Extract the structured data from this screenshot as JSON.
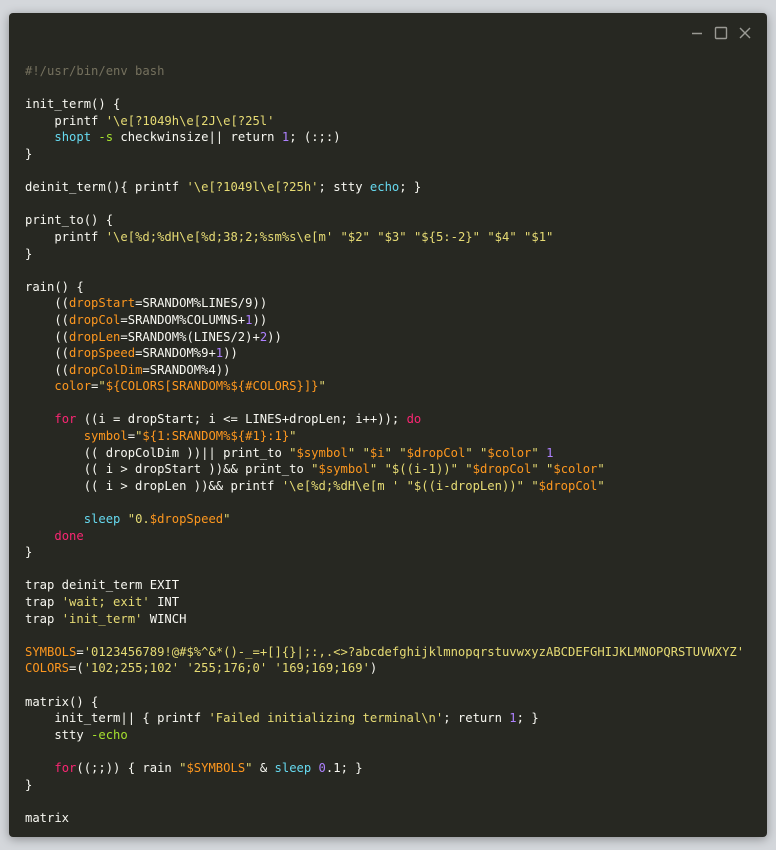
{
  "window": {
    "controls": [
      {
        "name": "minimize-button",
        "icon": "minimize-icon"
      },
      {
        "name": "maximize-button",
        "icon": "maximize-icon"
      },
      {
        "name": "close-button",
        "icon": "close-icon"
      }
    ]
  },
  "colors": {
    "background": "#272822",
    "text": "#f8f8f2",
    "comment": "#75715e",
    "string": "#e6db74",
    "builtin": "#66d9ef",
    "keyword": "#f92672",
    "number": "#ae81ff",
    "variable": "#fd971f",
    "flag": "#a6e22e"
  },
  "code_lines": [
    [
      [
        "comment",
        "#!/usr/bin/env bash"
      ]
    ],
    [],
    [
      [
        "default",
        "init_term() {"
      ]
    ],
    [
      [
        "default",
        "    printf "
      ],
      [
        "string",
        "'\\e[?1049h\\e[2J\\e[?25l'"
      ]
    ],
    [
      [
        "default",
        "    "
      ],
      [
        "builtin",
        "shopt"
      ],
      [
        "default",
        " "
      ],
      [
        "flag",
        "-s"
      ],
      [
        "default",
        " checkwinsize|| return "
      ],
      [
        "number",
        "1"
      ],
      [
        "default",
        "; (:;:)"
      ]
    ],
    [
      [
        "default",
        "}"
      ]
    ],
    [],
    [
      [
        "default",
        "deinit_term(){ printf "
      ],
      [
        "string",
        "'\\e[?1049l\\e[?25h'"
      ],
      [
        "default",
        "; stty "
      ],
      [
        "builtin",
        "echo"
      ],
      [
        "default",
        "; }"
      ]
    ],
    [],
    [
      [
        "default",
        "print_to() {"
      ]
    ],
    [
      [
        "default",
        "    printf "
      ],
      [
        "string",
        "'\\e[%d;%dH\\e[%d;38;2;%sm%s\\e[m'"
      ],
      [
        "default",
        " "
      ],
      [
        "string",
        "\"$2\""
      ],
      [
        "default",
        " "
      ],
      [
        "string",
        "\"$3\""
      ],
      [
        "default",
        " "
      ],
      [
        "string",
        "\"${5:-2}\""
      ],
      [
        "default",
        " "
      ],
      [
        "string",
        "\"$4\""
      ],
      [
        "default",
        " "
      ],
      [
        "string",
        "\"$1\""
      ]
    ],
    [
      [
        "default",
        "}"
      ]
    ],
    [],
    [
      [
        "default",
        "rain() {"
      ]
    ],
    [
      [
        "default",
        "    (("
      ],
      [
        "var",
        "dropStart"
      ],
      [
        "default",
        "=SRANDOM%LINES/9))"
      ]
    ],
    [
      [
        "default",
        "    (("
      ],
      [
        "var",
        "dropCol"
      ],
      [
        "default",
        "=SRANDOM%COLUMNS+"
      ],
      [
        "number",
        "1"
      ],
      [
        "default",
        "))"
      ]
    ],
    [
      [
        "default",
        "    (("
      ],
      [
        "var",
        "dropLen"
      ],
      [
        "default",
        "=SRANDOM%(LINES/2)+"
      ],
      [
        "number",
        "2"
      ],
      [
        "default",
        "))"
      ]
    ],
    [
      [
        "default",
        "    (("
      ],
      [
        "var",
        "dropSpeed"
      ],
      [
        "default",
        "=SRANDOM%9+"
      ],
      [
        "number",
        "1"
      ],
      [
        "default",
        "))"
      ]
    ],
    [
      [
        "default",
        "    (("
      ],
      [
        "var",
        "dropColDim"
      ],
      [
        "default",
        "=SRANDOM%4))"
      ]
    ],
    [
      [
        "default",
        "    "
      ],
      [
        "var",
        "color"
      ],
      [
        "default",
        "="
      ],
      [
        "string",
        "\""
      ],
      [
        "var",
        "${COLORS[SRANDOM%${#COLORS}]}"
      ],
      [
        "string",
        "\""
      ]
    ],
    [],
    [
      [
        "default",
        "    "
      ],
      [
        "keyword",
        "for"
      ],
      [
        "default",
        " ((i = dropStart; i <= LINES+dropLen; i++)); "
      ],
      [
        "keyword",
        "do"
      ]
    ],
    [
      [
        "default",
        "        "
      ],
      [
        "var",
        "symbol"
      ],
      [
        "default",
        "="
      ],
      [
        "string",
        "\""
      ],
      [
        "var",
        "${1:SRANDOM%${#1}:1}"
      ],
      [
        "string",
        "\""
      ]
    ],
    [
      [
        "default",
        "        (( dropColDim ))|| print_to "
      ],
      [
        "string",
        "\""
      ],
      [
        "var",
        "$symbol"
      ],
      [
        "string",
        "\""
      ],
      [
        "default",
        " "
      ],
      [
        "string",
        "\""
      ],
      [
        "var",
        "$i"
      ],
      [
        "string",
        "\""
      ],
      [
        "default",
        " "
      ],
      [
        "string",
        "\""
      ],
      [
        "var",
        "$dropCol"
      ],
      [
        "string",
        "\""
      ],
      [
        "default",
        " "
      ],
      [
        "string",
        "\""
      ],
      [
        "var",
        "$color"
      ],
      [
        "string",
        "\""
      ],
      [
        "default",
        " "
      ],
      [
        "number",
        "1"
      ]
    ],
    [
      [
        "default",
        "        (( i > dropStart ))&& print_to "
      ],
      [
        "string",
        "\""
      ],
      [
        "var",
        "$symbol"
      ],
      [
        "string",
        "\""
      ],
      [
        "default",
        " "
      ],
      [
        "string",
        "\"$((i-1))\""
      ],
      [
        "default",
        " "
      ],
      [
        "string",
        "\""
      ],
      [
        "var",
        "$dropCol"
      ],
      [
        "string",
        "\""
      ],
      [
        "default",
        " "
      ],
      [
        "string",
        "\""
      ],
      [
        "var",
        "$color"
      ],
      [
        "string",
        "\""
      ]
    ],
    [
      [
        "default",
        "        (( i > dropLen ))&& printf "
      ],
      [
        "string",
        "'\\e[%d;%dH\\e[m '"
      ],
      [
        "default",
        " "
      ],
      [
        "string",
        "\"$((i-dropLen))\""
      ],
      [
        "default",
        " "
      ],
      [
        "string",
        "\""
      ],
      [
        "var",
        "$dropCol"
      ],
      [
        "string",
        "\""
      ]
    ],
    [],
    [
      [
        "default",
        "        "
      ],
      [
        "builtin",
        "sleep"
      ],
      [
        "default",
        " "
      ],
      [
        "string",
        "\"0."
      ],
      [
        "var",
        "$dropSpeed"
      ],
      [
        "string",
        "\""
      ]
    ],
    [
      [
        "default",
        "    "
      ],
      [
        "keyword",
        "done"
      ]
    ],
    [
      [
        "default",
        "}"
      ]
    ],
    [],
    [
      [
        "default",
        "trap deinit_term EXIT"
      ]
    ],
    [
      [
        "default",
        "trap "
      ],
      [
        "string",
        "'wait; exit'"
      ],
      [
        "default",
        " INT"
      ]
    ],
    [
      [
        "default",
        "trap "
      ],
      [
        "string",
        "'init_term'"
      ],
      [
        "default",
        " WINCH"
      ]
    ],
    [],
    [
      [
        "var",
        "SYMBOLS"
      ],
      [
        "default",
        "="
      ],
      [
        "string",
        "'0123456789!@#$%^&*()-_=+[]{}|;:,.<>?abcdefghijklmnopqrstuvwxyzABCDEFGHIJKLMNOPQRSTUVWXYZ'"
      ]
    ],
    [
      [
        "var",
        "COLORS"
      ],
      [
        "default",
        "=("
      ],
      [
        "string",
        "'102;255;102'"
      ],
      [
        "default",
        " "
      ],
      [
        "string",
        "'255;176;0'"
      ],
      [
        "default",
        " "
      ],
      [
        "string",
        "'169;169;169'"
      ],
      [
        "default",
        ")"
      ]
    ],
    [],
    [
      [
        "default",
        "matrix() {"
      ]
    ],
    [
      [
        "default",
        "    init_term|| { printf "
      ],
      [
        "string",
        "'Failed initializing terminal\\n'"
      ],
      [
        "default",
        "; return "
      ],
      [
        "number",
        "1"
      ],
      [
        "default",
        "; }"
      ]
    ],
    [
      [
        "default",
        "    stty "
      ],
      [
        "flag",
        "-echo"
      ]
    ],
    [],
    [
      [
        "default",
        "    "
      ],
      [
        "keyword",
        "for"
      ],
      [
        "default",
        "((;;)) { rain "
      ],
      [
        "string",
        "\""
      ],
      [
        "var",
        "$SYMBOLS"
      ],
      [
        "string",
        "\""
      ],
      [
        "default",
        " & "
      ],
      [
        "builtin",
        "sleep"
      ],
      [
        "default",
        " "
      ],
      [
        "number",
        "0"
      ],
      [
        "default",
        ".1; }"
      ]
    ],
    [
      [
        "default",
        "}"
      ]
    ],
    [],
    [
      [
        "default",
        "matrix"
      ]
    ]
  ]
}
